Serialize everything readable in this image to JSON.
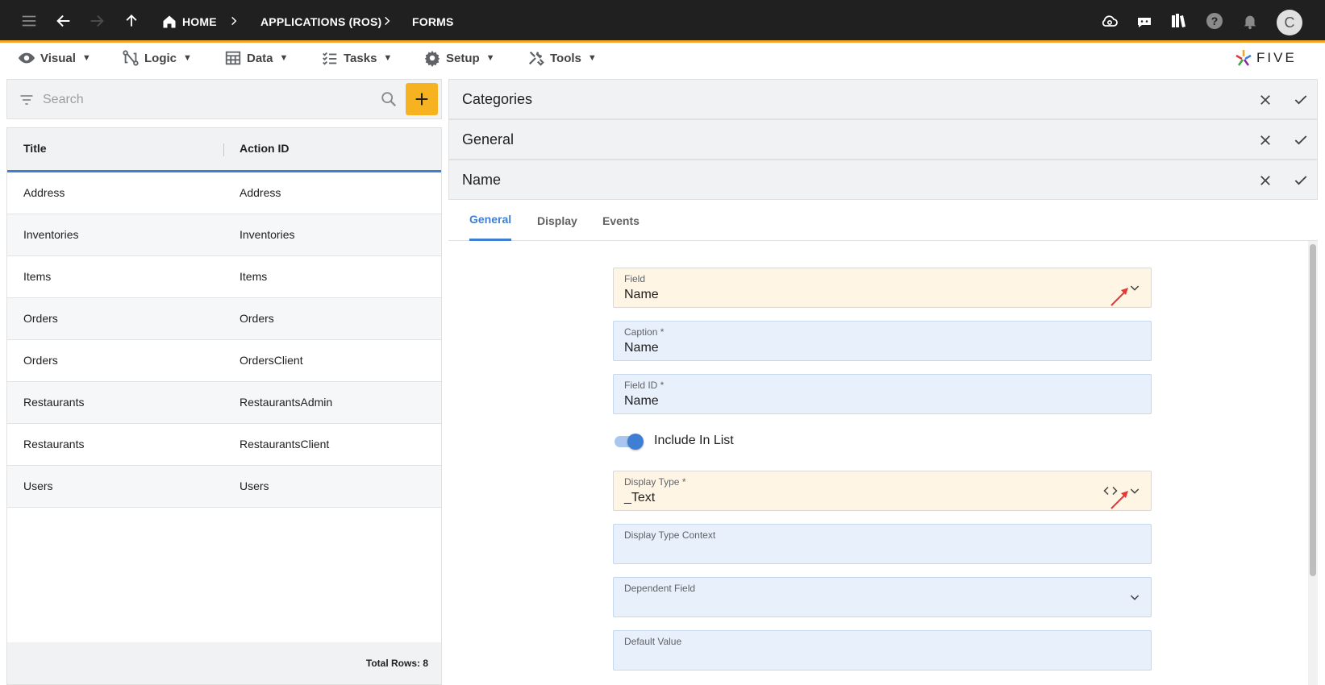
{
  "topbar": {
    "breadcrumbs": [
      "HOME",
      "APPLICATIONS (ROS)",
      "FORMS"
    ],
    "avatar_initial": "C"
  },
  "menu": [
    {
      "label": "Visual",
      "icon": "eye-icon"
    },
    {
      "label": "Logic",
      "icon": "logic-icon"
    },
    {
      "label": "Data",
      "icon": "table-icon"
    },
    {
      "label": "Tasks",
      "icon": "tasks-icon"
    },
    {
      "label": "Setup",
      "icon": "gear-icon"
    },
    {
      "label": "Tools",
      "icon": "tools-icon"
    }
  ],
  "logo_text": "FIVE",
  "search": {
    "placeholder": "Search"
  },
  "table": {
    "headers": [
      "Title",
      "Action ID"
    ],
    "rows": [
      [
        "Address",
        "Address"
      ],
      [
        "Inventories",
        "Inventories"
      ],
      [
        "Items",
        "Items"
      ],
      [
        "Orders",
        "Orders"
      ],
      [
        "Orders",
        "OrdersClient"
      ],
      [
        "Restaurants",
        "RestaurantsAdmin"
      ],
      [
        "Restaurants",
        "RestaurantsClient"
      ],
      [
        "Users",
        "Users"
      ]
    ],
    "total": "Total Rows: 8"
  },
  "panels": [
    "Categories",
    "General",
    "Name"
  ],
  "tabs": [
    "General",
    "Display",
    "Events"
  ],
  "form": {
    "field_label": "Field",
    "field_value": "Name",
    "caption_label": "Caption *",
    "caption_value": "Name",
    "fieldid_label": "Field ID *",
    "fieldid_value": "Name",
    "include_label": "Include In List",
    "include_on": true,
    "displaytype_label": "Display Type *",
    "displaytype_value": "_Text",
    "displaycontext_label": "Display Type Context",
    "dependent_label": "Dependent Field",
    "default_label": "Default Value"
  },
  "colors": {
    "topbar": "#202020",
    "accent_orange": "#f5a623",
    "accent_blue": "#3f7fd3",
    "lookup_field": "#fff5e5",
    "input_field": "#e8f0fb",
    "annotation_arrow": "#e53935"
  }
}
